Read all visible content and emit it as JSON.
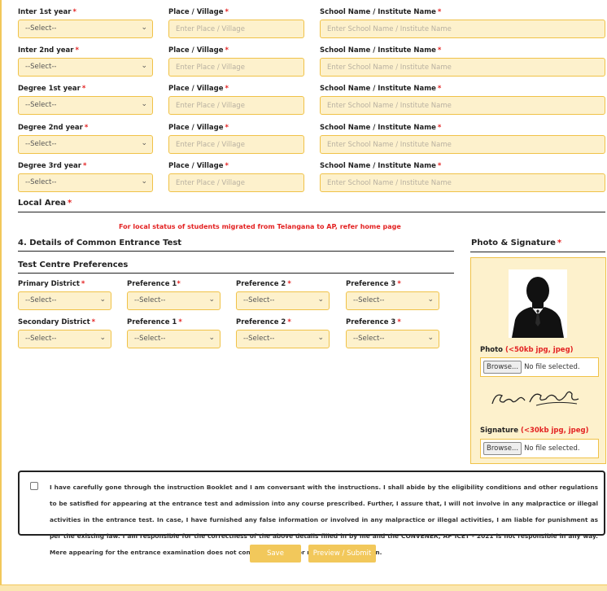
{
  "education": {
    "place_label": "Place / Village",
    "school_label": "School Name / Institute Name",
    "select_default": "--Select--",
    "place_placeholder": "Enter Place / Village",
    "school_placeholder": "Enter School Name / Institute Name",
    "rows": [
      {
        "label": "Inter 1st year"
      },
      {
        "label": "Inter 2nd year"
      },
      {
        "label": "Degree 1st year"
      },
      {
        "label": "Degree 2nd year"
      },
      {
        "label": "Degree 3rd year"
      }
    ]
  },
  "local_area": {
    "label": "Local Area",
    "note": "For local status of students migrated from Telangana to AP, refer home page"
  },
  "cet": {
    "heading": "4. Details of Common Entrance Test",
    "subheading": "Test Centre Preferences",
    "primary_label": "Primary District",
    "secondary_label": "Secondary District",
    "pref1_label": "Preference 1",
    "pref2_label": "Preference 2",
    "pref3_label": "Preference 3",
    "select_default": "--Select--"
  },
  "photo": {
    "heading": "Photo & Signature",
    "photo_label": "Photo",
    "photo_hint": "(<50kb jpg, jpeg)",
    "signature_label": "Signature",
    "signature_hint": "(<30kb jpg, jpeg)",
    "browse_label": "Browse...",
    "no_file": "No file selected."
  },
  "declaration": {
    "text": "I have carefully gone through the instruction Booklet and I am conversant with the instructions. I shall abide by the eligibility conditions and other regulations to be satisfied for appearing at the entrance test and admission into any course prescribed. Further, I assure that, I will not involve in any malpractice or illegal activities in the entrance test. In case, I have furnished any false information or involved in any malpractice or illegal activities, I am liable for punishment as per the existing law. I am responsible for the correctness of the above details filled in by me and the CONVENER, AP ICET - 2021 is not responsible in any way. Mere appearing for the entrance examination does not confer any right for me to take admission."
  },
  "actions": {
    "save": "Save",
    "preview_submit": "Preview / Submit"
  },
  "colors": {
    "field_bg": "#fdf1cc",
    "field_border": "#f0c248",
    "required": "#e32222",
    "button": "#f2c85b"
  }
}
